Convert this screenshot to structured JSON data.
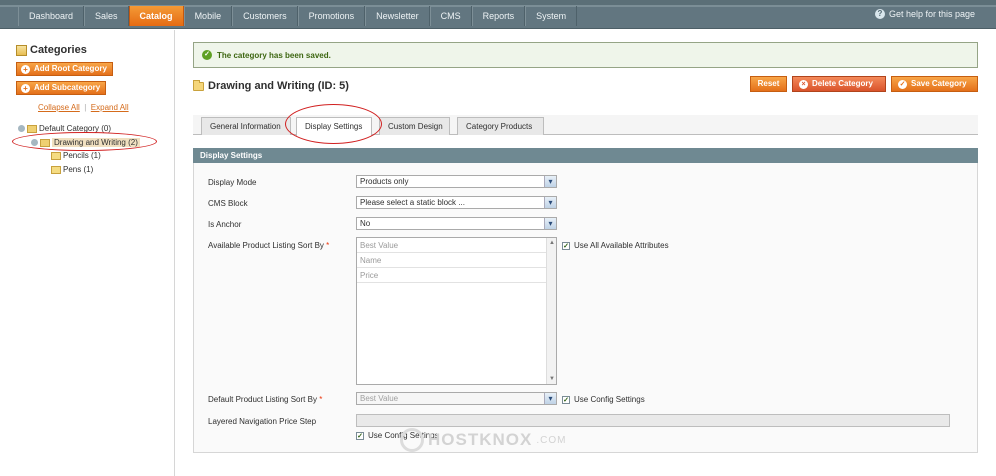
{
  "nav": {
    "items": [
      "Dashboard",
      "Sales",
      "Catalog",
      "Mobile",
      "Customers",
      "Promotions",
      "Newsletter",
      "CMS",
      "Reports",
      "System"
    ],
    "active": "Catalog",
    "help": "Get help for this page"
  },
  "sidebar": {
    "title": "Categories",
    "add_root": "Add Root Category",
    "add_sub": "Add Subcategory",
    "collapse_all": "Collapse All",
    "separator": "|",
    "expand_all": "Expand All",
    "tree": {
      "root": "Default Category (0)",
      "selected": "Drawing and Writing (2)",
      "children": [
        "Pencils (1)",
        "Pens (1)"
      ]
    }
  },
  "main": {
    "success_message": "The category has been saved.",
    "title": "Drawing and Writing (ID: 5)",
    "buttons": {
      "reset": "Reset",
      "delete": "Delete Category",
      "save": "Save Category"
    },
    "tabs": [
      "General Information",
      "Display Settings",
      "Custom Design",
      "Category Products"
    ],
    "active_tab": "Display Settings",
    "section_title": "Display Settings",
    "fields": {
      "display_mode": {
        "label": "Display Mode",
        "value": "Products only"
      },
      "cms_block": {
        "label": "CMS Block",
        "value": "Please select a static block ..."
      },
      "is_anchor": {
        "label": "Is Anchor",
        "value": "No"
      },
      "available_sort": {
        "label": "Available Product Listing Sort By",
        "required": "*",
        "options": [
          "Best Value",
          "Name",
          "Price"
        ],
        "use_all_label": "Use All Available Attributes",
        "use_all_checked": true
      },
      "default_sort": {
        "label": "Default Product Listing Sort By",
        "required": "*",
        "value": "Best Value",
        "use_config_label": "Use Config Settings",
        "use_config_checked": true
      },
      "price_step": {
        "label": "Layered Navigation Price Step",
        "value": "",
        "use_config_label": "Use Config Settings",
        "use_config_checked": true
      }
    }
  },
  "watermark": {
    "text": "HOSTKNOX",
    "suffix": ".COM"
  },
  "colors": {
    "accent": "#e4701a",
    "nav_bg": "#627680",
    "section_header": "#6f8992",
    "success_bg": "#eff5ea",
    "highlight_circle": "#d12020"
  }
}
